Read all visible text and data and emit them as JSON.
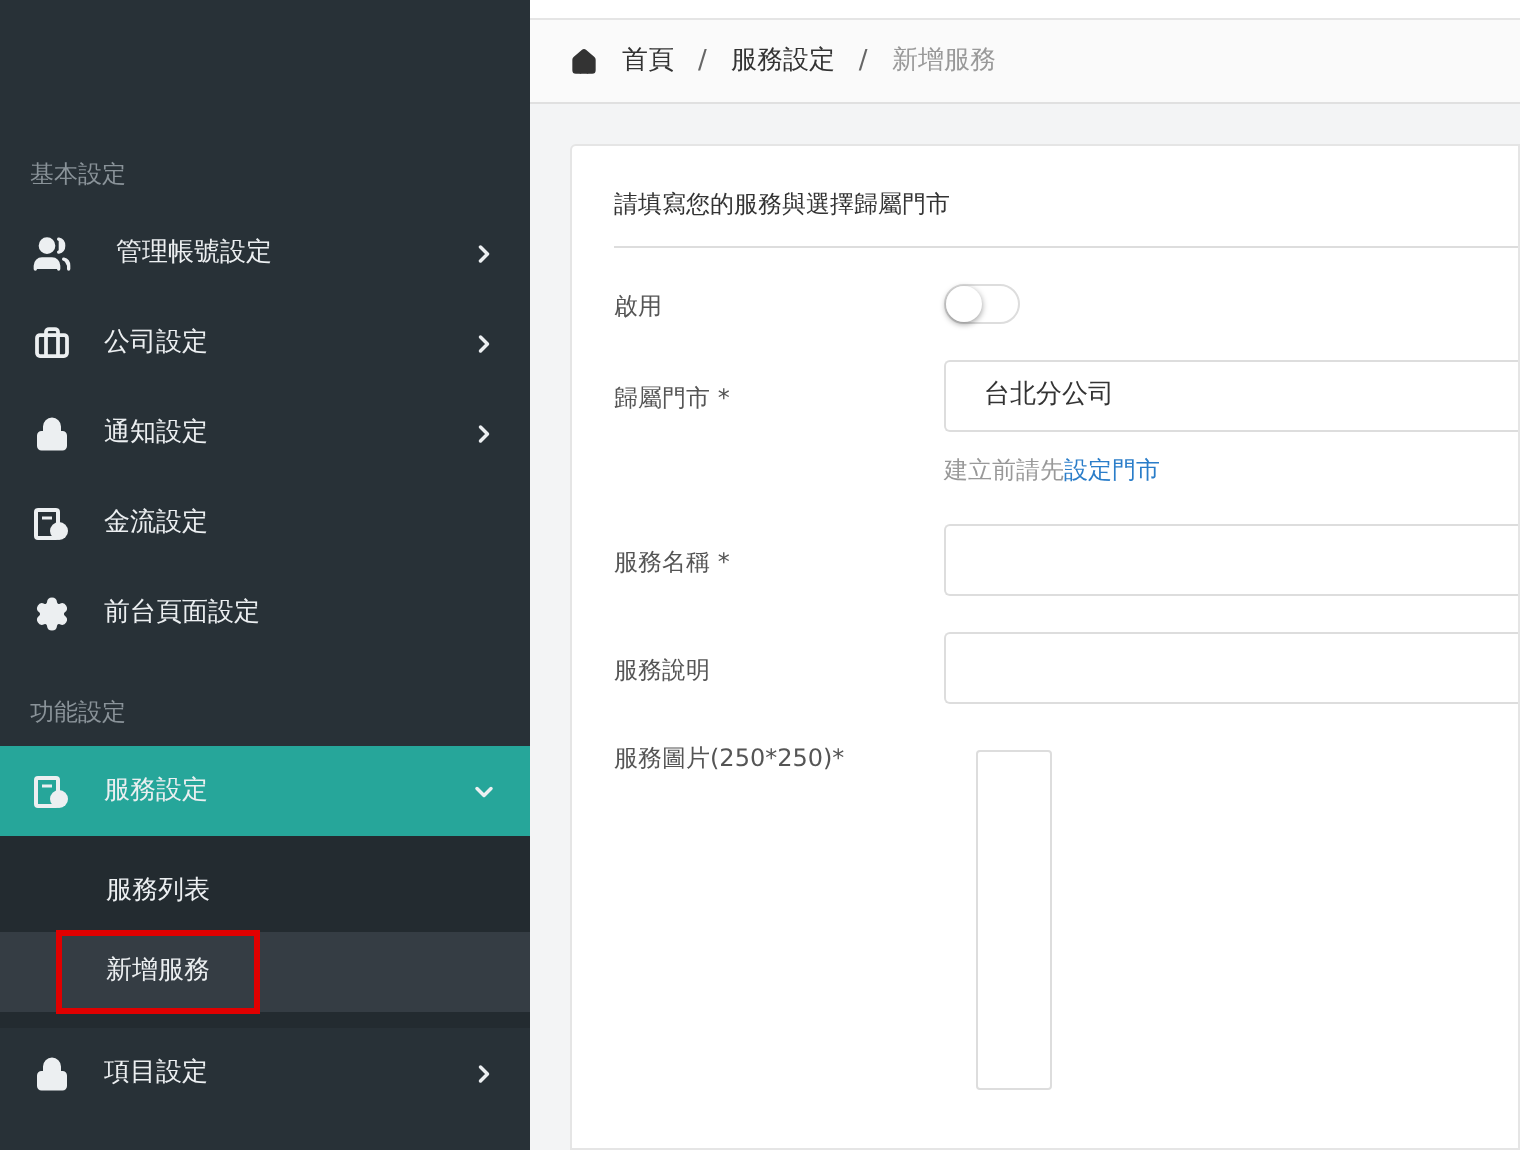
{
  "sidebar": {
    "sections": [
      {
        "label": "基本設定",
        "items": [
          {
            "label": "管理帳號設定",
            "selected": false,
            "expanded": false
          },
          {
            "label": "公司設定",
            "selected": false,
            "expanded": false
          },
          {
            "label": "通知設定",
            "selected": false,
            "expanded": false
          },
          {
            "label": "金流設定",
            "selected": false
          },
          {
            "label": "前台頁面設定",
            "selected": false
          }
        ]
      },
      {
        "label": "功能設定",
        "items": [
          {
            "label": "服務設定",
            "selected": true,
            "expanded": true,
            "children": [
              {
                "label": "服務列表",
                "selected": false,
                "highlighted": false
              },
              {
                "label": "新增服務",
                "selected": true,
                "highlighted": true
              }
            ]
          },
          {
            "label": "項目設定",
            "selected": false,
            "expanded": false
          }
        ]
      }
    ]
  },
  "breadcrumb": [
    {
      "label": "首頁",
      "current": false
    },
    {
      "label": "服務設定",
      "current": false
    },
    {
      "label": "新增服務",
      "current": true
    }
  ],
  "breadcrumb_separator": "/",
  "form": {
    "title": "請填寫您的服務與選擇歸屬門市",
    "fields": [
      {
        "kind": "toggle",
        "label": "啟用",
        "on": false
      },
      {
        "kind": "select",
        "label": "歸屬門市 *",
        "value": "台北分公司",
        "help": "建立前請先",
        "help_link": "設定門市"
      },
      {
        "kind": "text",
        "label": "服務名稱 *"
      },
      {
        "kind": "text",
        "label": "服務說明"
      },
      {
        "kind": "image",
        "label": "服務圖片(250*250)*"
      }
    ]
  }
}
